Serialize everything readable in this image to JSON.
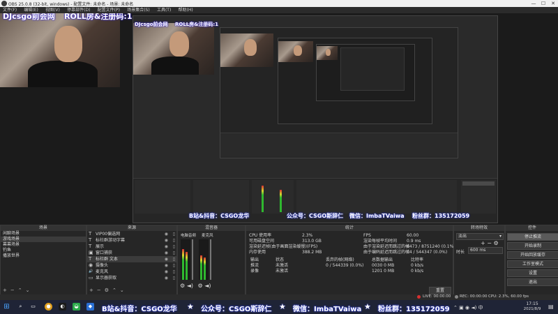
{
  "window": {
    "title": "OBS 25.0.8 (32-bit, windows) - 配置文件: 未命名 - 场景: 未命名",
    "minimize": "—",
    "maximize": "☐",
    "close": "✕"
  },
  "menu": [
    "文件(F)",
    "编辑(E)",
    "视图(V)",
    "停靠部件(D)",
    "配置文件(P)",
    "场景集合(S)",
    "工具(T)",
    "帮助(H)"
  ],
  "overlay": {
    "left_text": "DJcsgo前会网",
    "right_text": "ROLL房&注册码:1"
  },
  "scenes_panel": {
    "title": "场景",
    "items": [
      "闲聊场景",
      "游戏场景",
      "幕幕场景",
      "钓鱼",
      "播放世界"
    ],
    "selected_index": 1
  },
  "sources_panel": {
    "title": "来源",
    "items": [
      {
        "icon": "T",
        "label": "VIP00偏选网"
      },
      {
        "icon": "T",
        "label": "标社群游动字幕"
      },
      {
        "icon": "T",
        "label": "展示"
      },
      {
        "icon": "▣",
        "label": "窗口捕获"
      },
      {
        "icon": "T",
        "label": "标社群 文本"
      },
      {
        "icon": "◉",
        "label": "摄像头"
      },
      {
        "icon": "🔊",
        "label": "麦克风"
      },
      {
        "icon": "▭",
        "label": "显示器获取"
      }
    ],
    "selected_index": 4
  },
  "mixer_panel": {
    "title": "混音器",
    "channels": [
      {
        "name": "电脑音频",
        "level": 0.75
      },
      {
        "name": "麦克风",
        "level": 0.6
      }
    ]
  },
  "stats_panel": {
    "title": "统计",
    "left": [
      {
        "label": "CPU 使用率",
        "value": "2.3%"
      },
      {
        "label": "可用磁盘空间",
        "value": "313.0 GB"
      },
      {
        "label": "渲染延迟帧(由于画面渲染缓慢)(FPS)",
        "value": ""
      },
      {
        "label": "内存使用",
        "value": "388.2 MB"
      }
    ],
    "right": [
      {
        "label": "FPS",
        "value": "60.00"
      },
      {
        "label": "渲染每帧平均时间",
        "value": "0.9 ms"
      },
      {
        "label": "由于渲染延迟而跳过的帧",
        "value": "8473 / 8751240 (0.1%)"
      },
      {
        "label": "由于编码延迟而跳过的帧",
        "value": "14 / 544347 (0.0%)"
      }
    ],
    "table_headers": [
      "输出",
      "状态",
      "丢弃的帧(网络)",
      "总数据输出",
      "比特率"
    ],
    "table_rows": [
      [
        "推流",
        "未激活",
        "0 / 544339 (0.0%)",
        "0030 0 MB",
        "0 kb/s"
      ],
      [
        "录像",
        "未激活",
        "",
        "1201 0 MB",
        "0 kb/s"
      ]
    ],
    "reset_label": "重置"
  },
  "transitions_panel": {
    "title": "转场特效",
    "selected": "淡出",
    "duration_label": "时长",
    "duration_value": "600 ms"
  },
  "controls_panel": {
    "title": "控件",
    "buttons": [
      "停止推流",
      "开始录制",
      "开始回放缓存",
      "工作室模式",
      "设置",
      "退出"
    ]
  },
  "statusbar": {
    "live": "LIVE: 00:00:00",
    "rec": "REC: 00:00:00",
    "cpu": "CPU: 2.3%, 60.00 fps"
  },
  "taskbar": {
    "ticker": [
      "B站&抖音：CSGO龙华",
      "公众号：CSGO斯辞仁",
      "微信：ImbaTVaiwa",
      "粉丝群：135172059"
    ],
    "time": "17:15",
    "date": "2021/8/9"
  },
  "colors": {
    "panel_bg": "#262626",
    "overlay_glow": "#3a2bd0",
    "meter_green": "#2fb82f",
    "taskbar_bg": "#1f2436"
  }
}
